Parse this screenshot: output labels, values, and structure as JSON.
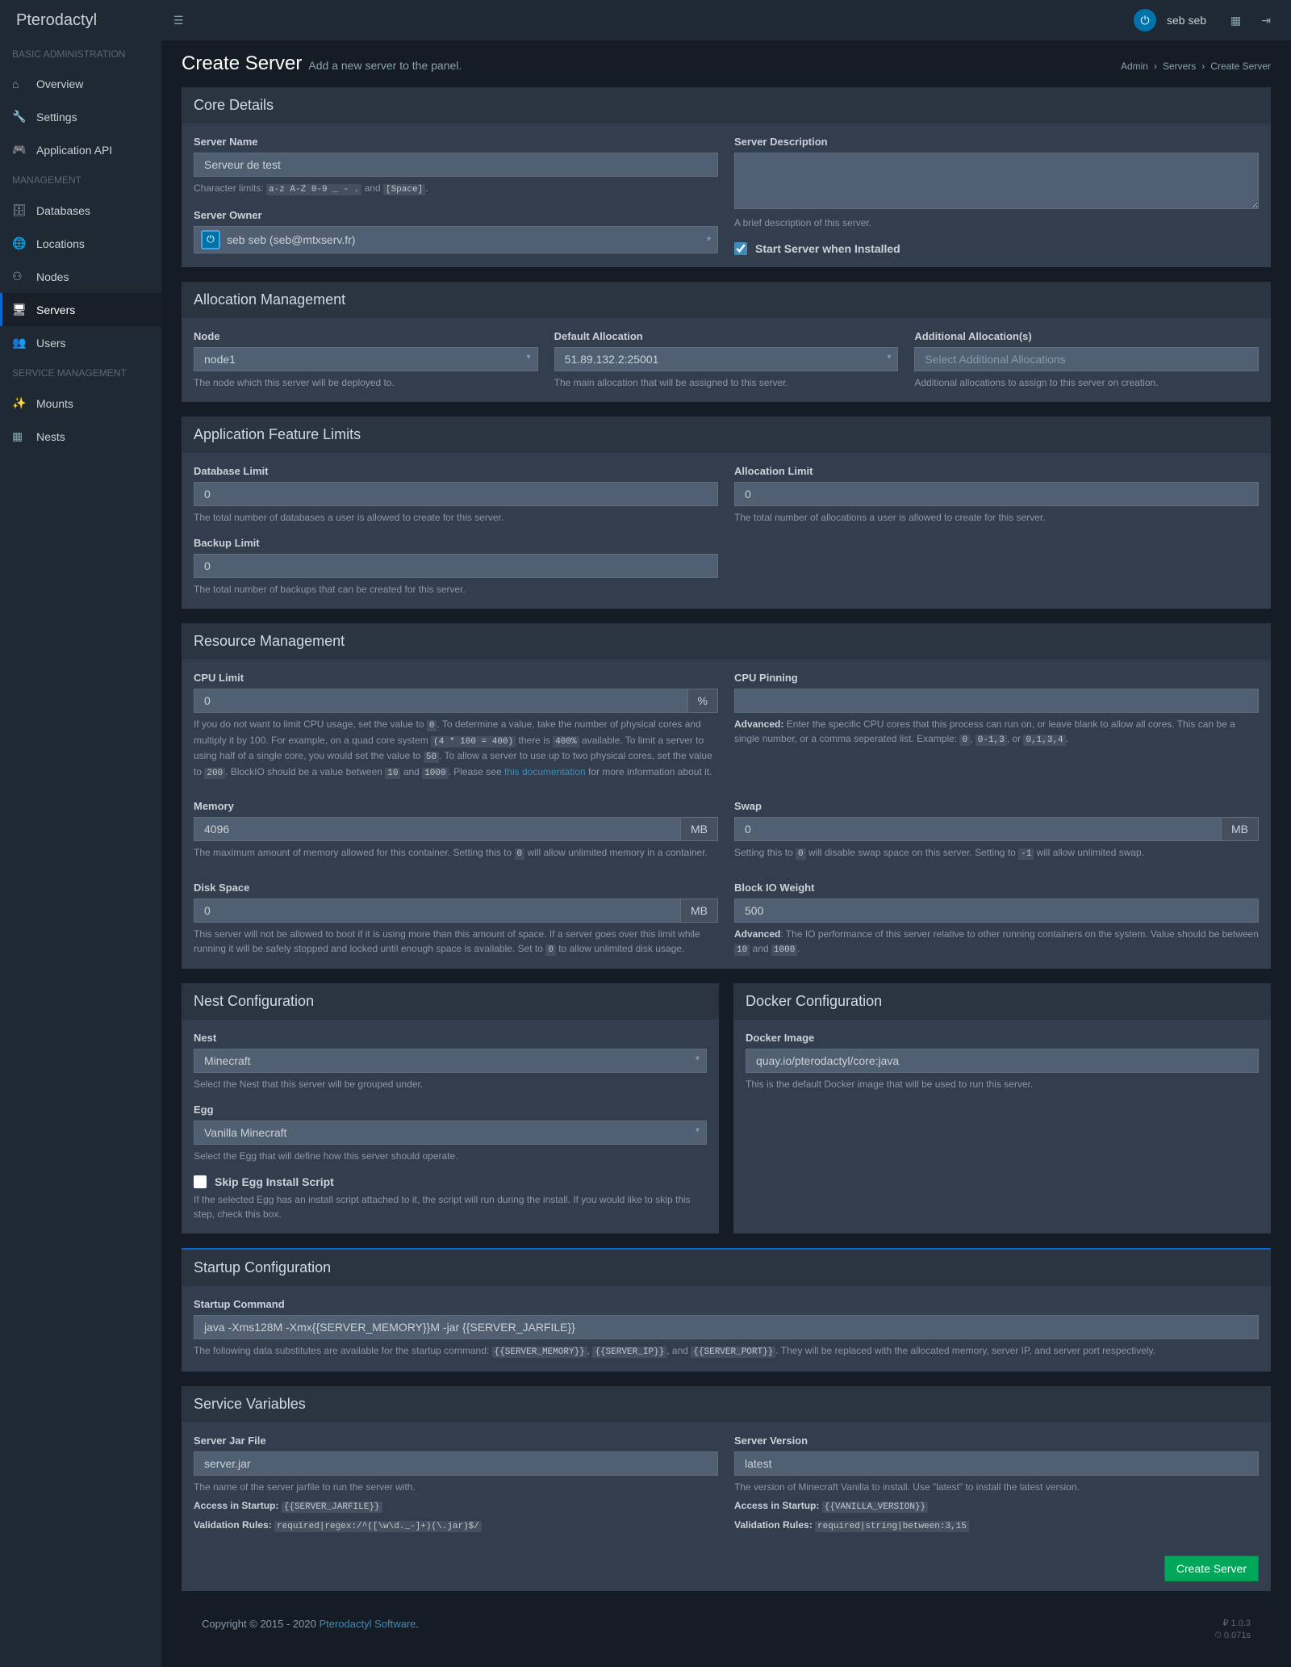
{
  "app": {
    "name": "Pterodactyl"
  },
  "user": {
    "name": "seb seb"
  },
  "breadcrumb": {
    "admin": "Admin",
    "servers": "Servers",
    "current": "Create Server"
  },
  "page": {
    "title": "Create Server",
    "subtitle": "Add a new server to the panel."
  },
  "sidebar": {
    "sections": {
      "basic": "BASIC ADMINISTRATION",
      "management": "MANAGEMENT",
      "service": "SERVICE MANAGEMENT"
    },
    "items": {
      "overview": "Overview",
      "settings": "Settings",
      "api": "Application API",
      "databases": "Databases",
      "locations": "Locations",
      "nodes": "Nodes",
      "servers": "Servers",
      "users": "Users",
      "mounts": "Mounts",
      "nests": "Nests"
    }
  },
  "core": {
    "header": "Core Details",
    "name_label": "Server Name",
    "name_value": "Serveur de test",
    "char_limits": "Character limits:",
    "char_rule1": "a-z A-Z 0-9 _ - .",
    "char_and": "and",
    "char_rule2": "[Space]",
    "owner_label": "Server Owner",
    "owner_display": "seb seb (seb@mtxserv.fr)",
    "desc_label": "Server Description",
    "desc_help": "A brief description of this server.",
    "start_label": "Start Server when Installed"
  },
  "alloc": {
    "header": "Allocation Management",
    "node_label": "Node",
    "node_value": "node1",
    "node_help": "The node which this server will be deployed to.",
    "default_label": "Default Allocation",
    "default_value": "51.89.132.2:25001",
    "default_help": "The main allocation that will be assigned to this server.",
    "add_label": "Additional Allocation(s)",
    "add_placeholder": "Select Additional Allocations",
    "add_help": "Additional allocations to assign to this server on creation."
  },
  "limits": {
    "header": "Application Feature Limits",
    "db_label": "Database Limit",
    "db_value": "0",
    "db_help": "The total number of databases a user is allowed to create for this server.",
    "alloc_label": "Allocation Limit",
    "alloc_value": "0",
    "alloc_help": "The total number of allocations a user is allowed to create for this server.",
    "backup_label": "Backup Limit",
    "backup_value": "0",
    "backup_help": "The total number of backups that can be created for this server."
  },
  "resource": {
    "header": "Resource Management",
    "cpu_label": "CPU Limit",
    "cpu_value": "0",
    "cpu_unit": "%",
    "cpu_help1": "If you do not want to limit CPU usage, set the value to ",
    "cpu_code0": "0",
    "cpu_help2": ". To determine a value, take the number of physical cores and multiply it by 100. For example, on a quad core system ",
    "cpu_code1": "(4 * 100 = 400)",
    "cpu_help3": " there is ",
    "cpu_code2": "400%",
    "cpu_help4": " available. To limit a server to using half of a single core, you would set the value to ",
    "cpu_code3": "50",
    "cpu_help5": ". To allow a server to use up to two physical cores, set the value to ",
    "cpu_code4": "200",
    "cpu_help6": ". BlockIO should be a value between ",
    "cpu_code5": "10",
    "cpu_help7": " and ",
    "cpu_code6": "1000",
    "cpu_help8": ". Please see ",
    "cpu_doclink": "this documentation",
    "cpu_help9": " for more information about it.",
    "pin_label": "CPU Pinning",
    "pin_help_strong": "Advanced:",
    "pin_help1": " Enter the specific CPU cores that this process can run on, or leave blank to allow all cores. This can be a single number, or a comma seperated list. Example: ",
    "pin_code0": "0",
    "pin_help2": ", ",
    "pin_code1": "0-1,3",
    "pin_help3": ", or ",
    "pin_code2": "0,1,3,4",
    "pin_help4": ".",
    "mem_label": "Memory",
    "mem_value": "4096",
    "mem_unit": "MB",
    "mem_help1": "The maximum amount of memory allowed for this container. Setting this to ",
    "mem_code0": "0",
    "mem_help2": " will allow unlimited memory in a container.",
    "swap_label": "Swap",
    "swap_value": "0",
    "swap_unit": "MB",
    "swap_help1": "Setting this to ",
    "swap_code0": "0",
    "swap_help2": " will disable swap space on this server. Setting to ",
    "swap_code1": "-1",
    "swap_help3": " will allow unlimited swap.",
    "disk_label": "Disk Space",
    "disk_value": "0",
    "disk_unit": "MB",
    "disk_help1": "This server will not be allowed to boot if it is using more than this amount of space. If a server goes over this limit while running it will be safely stopped and locked until enough space is available. Set to ",
    "disk_code0": "0",
    "disk_help2": " to allow unlimited disk usage.",
    "bio_label": "Block IO Weight",
    "bio_value": "500",
    "bio_help_strong": "Advanced",
    "bio_help1": ": The IO performance of this server relative to other running containers on the system. Value should be between ",
    "bio_code0": "10",
    "bio_help2": " and ",
    "bio_code1": "1000",
    "bio_help3": "."
  },
  "nest": {
    "header": "Nest Configuration",
    "nest_label": "Nest",
    "nest_value": "Minecraft",
    "nest_help": "Select the Nest that this server will be grouped under.",
    "egg_label": "Egg",
    "egg_value": "Vanilla Minecraft",
    "egg_help": "Select the Egg that will define how this server should operate.",
    "skip_label": "Skip Egg Install Script",
    "skip_help": "If the selected Egg has an install script attached to it, the script will run during the install. If you would like to skip this step, check this box."
  },
  "docker": {
    "header": "Docker Configuration",
    "image_label": "Docker Image",
    "image_value": "quay.io/pterodactyl/core:java",
    "image_help": "This is the default Docker image that will be used to run this server."
  },
  "startup": {
    "header": "Startup Configuration",
    "cmd_label": "Startup Command",
    "cmd_value": "java -Xms128M -Xmx{{SERVER_MEMORY}}M -jar {{SERVER_JARFILE}}",
    "cmd_help1": "The following data substitutes are available for the startup command: ",
    "cmd_sub1": "{{SERVER_MEMORY}}",
    "cmd_help2": ", ",
    "cmd_sub2": "{{SERVER_IP}}",
    "cmd_help3": ", and ",
    "cmd_sub3": "{{SERVER_PORT}}",
    "cmd_help4": ". They will be replaced with the allocated memory, server IP, and server port respectively."
  },
  "vars": {
    "header": "Service Variables",
    "jar_label": "Server Jar File",
    "jar_value": "server.jar",
    "jar_help": "The name of the server jarfile to run the server with.",
    "access": "Access in Startup:",
    "validation": "Validation Rules:",
    "jar_access": "{{SERVER_JARFILE}}",
    "jar_rules": "required|regex:/^([\\w\\d._-]+)(\\.jar)$/",
    "ver_label": "Server Version",
    "ver_value": "latest",
    "ver_help": "The version of Minecraft Vanilla to install. Use \"latest\" to install the latest version.",
    "ver_access": "{{VANILLA_VERSION}}",
    "ver_rules": "required|string|between:3,15"
  },
  "submit": {
    "label": "Create Server"
  },
  "footer": {
    "copyright": "Copyright © 2015 - 2020 ",
    "link": "Pterodactyl Software",
    "dot": ".",
    "version_icon": "₽",
    "version": "1.0.3",
    "time_icon": "⏱",
    "time": "0.071s"
  }
}
